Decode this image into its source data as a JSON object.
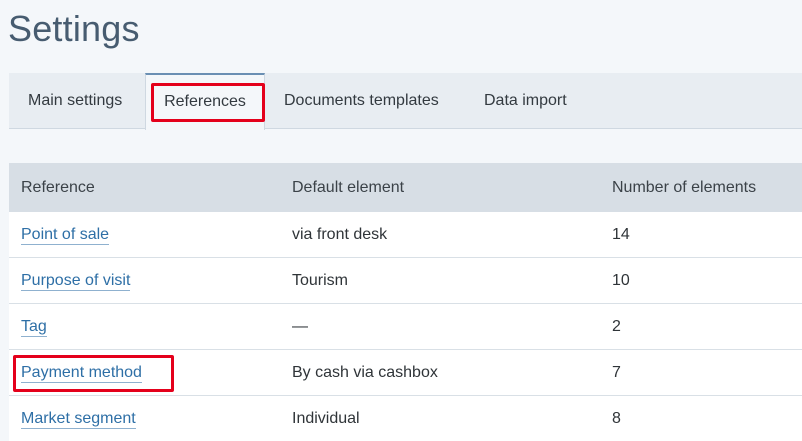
{
  "page": {
    "title": "Settings"
  },
  "tabs": [
    {
      "label": "Main settings"
    },
    {
      "label": "References",
      "active": true
    },
    {
      "label": "Documents templates"
    },
    {
      "label": "Data import"
    }
  ],
  "table": {
    "headers": [
      "Reference",
      "Default element",
      "Number of elements"
    ],
    "rows": [
      {
        "reference": "Point of sale",
        "default_element": "via front desk",
        "count": "14"
      },
      {
        "reference": "Purpose of visit",
        "default_element": "Tourism",
        "count": "10"
      },
      {
        "reference": "Tag",
        "default_element": "—",
        "count": "2"
      },
      {
        "reference": "Payment method",
        "default_element": "By cash via cashbox",
        "count": "7"
      },
      {
        "reference": "Market segment",
        "default_element": "Individual",
        "count": "8"
      }
    ]
  },
  "colors": {
    "accent_link": "#2e6fa6",
    "highlight_box": "#e4001b",
    "header_bg": "#d7dee5",
    "title": "#475c70"
  }
}
